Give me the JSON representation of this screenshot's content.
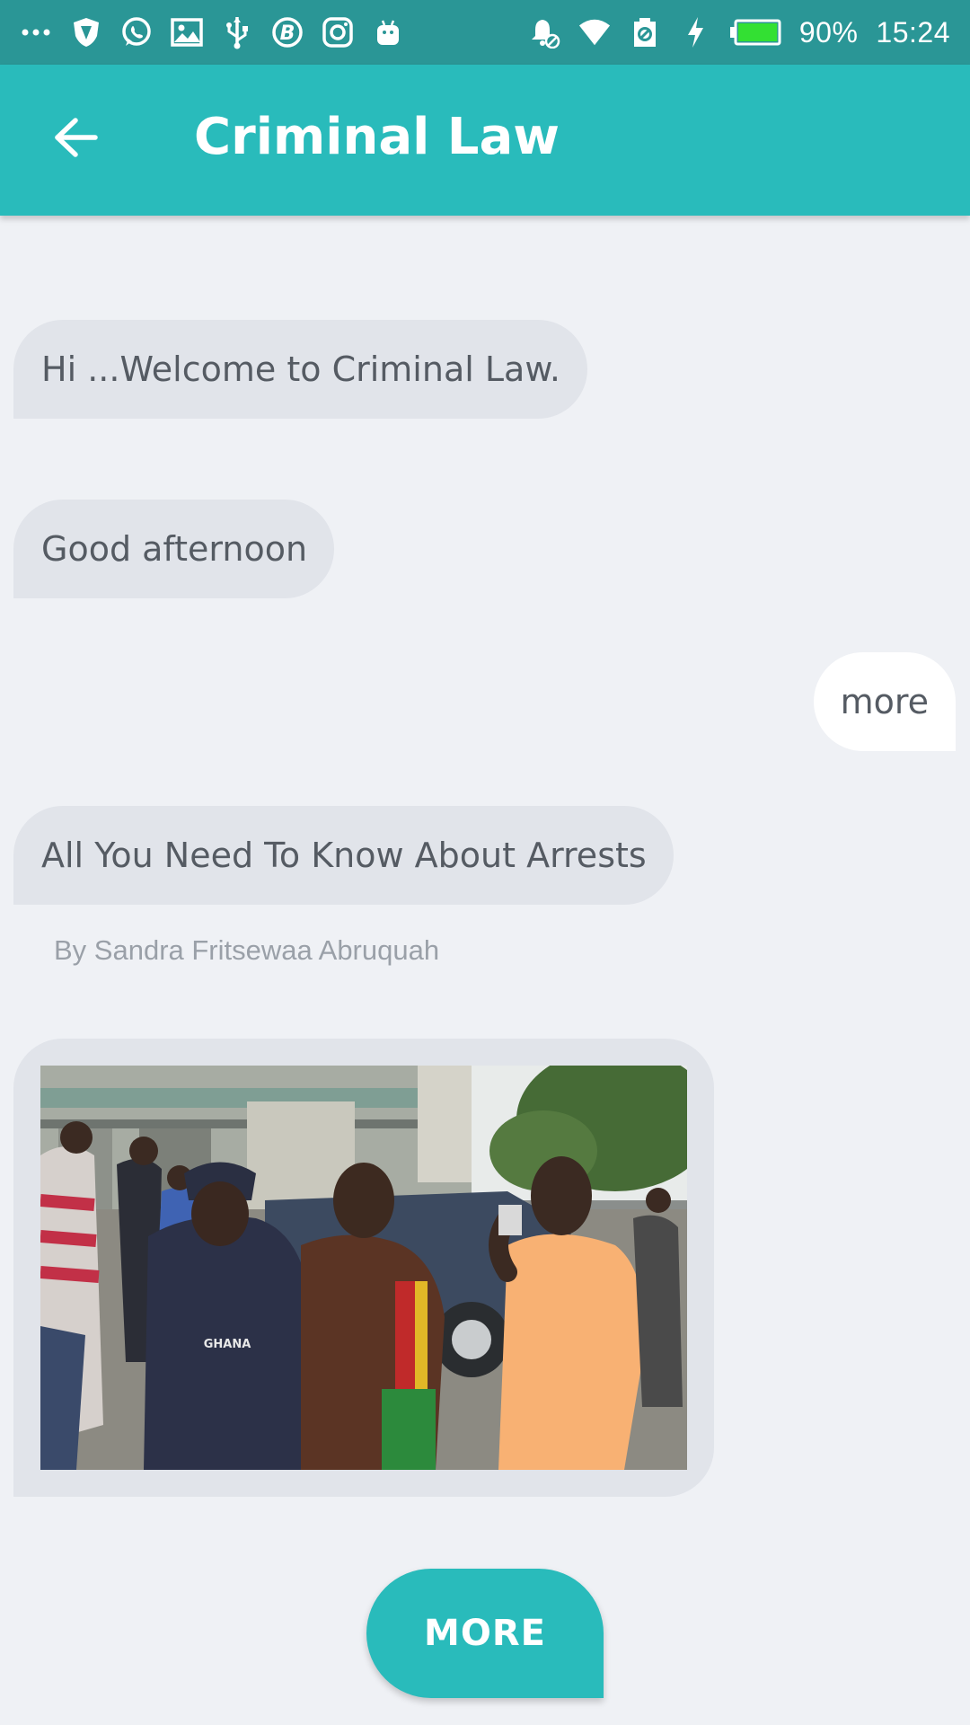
{
  "status_bar": {
    "battery_percent": "90%",
    "time": "15:24",
    "left_icons": [
      "more-dots-icon",
      "shield-icon",
      "whatsapp-icon",
      "gallery-icon",
      "usb-icon",
      "b-app-icon",
      "instagram-icon",
      "android-icon"
    ],
    "right_icons": [
      "alarm-off-icon",
      "wifi-icon",
      "data-saver-icon",
      "charging-icon",
      "battery-icon"
    ],
    "battery_level": 0.9
  },
  "app_bar": {
    "title": "Criminal Law",
    "back_icon": "arrow-left-icon"
  },
  "messages": [
    {
      "sender": "bot",
      "text": "Hi ...Welcome to Criminal Law."
    },
    {
      "sender": "bot",
      "text": "Good afternoon"
    },
    {
      "sender": "user",
      "text": "more"
    },
    {
      "sender": "bot",
      "text": "All You Need To Know About Arrests"
    }
  ],
  "byline": "By Sandra Fritsewaa Abruquah",
  "photo": {
    "badge_text": "GHANA"
  },
  "more_button": {
    "label": "MORE"
  },
  "colors": {
    "status_bar": "#2a9696",
    "app_bar": "#29bbbb",
    "background": "#eff1f5",
    "bot_bubble": "#e1e4ea",
    "user_bubble": "#ffffff",
    "button": "#29bbbb"
  }
}
